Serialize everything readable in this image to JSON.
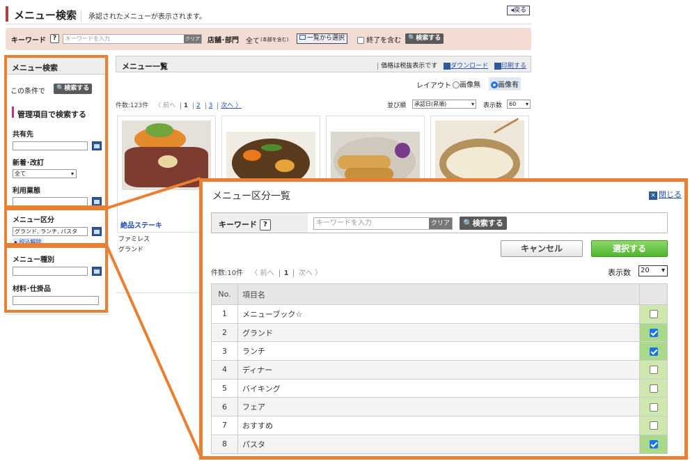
{
  "header": {
    "title": "メニュー検索",
    "description": "承認されたメニューが表示されます。",
    "back": "◂戻る"
  },
  "searchbar": {
    "keyword_label": "キーワード",
    "help": "?",
    "keyword_placeholder": "キーワードを入力",
    "clear": "クリア",
    "store_label": "店舗･部門",
    "store_value": "全て",
    "store_note": "(本部を含む)",
    "list_select": "一覧から選択",
    "include_ended": "終了を含む",
    "search": "検索する"
  },
  "sidebar": {
    "title": "メニュー検索",
    "this_condition": "この条件で",
    "search": "検索する",
    "section": "管理項目で検索する",
    "shared_label": "共有先",
    "new_label": "新着･改訂",
    "new_value": "全て",
    "usage_label": "利用業態",
    "category_label": "メニュー区分",
    "category_value": "グランド, ランチ, パスタ",
    "filter_clear": "絞込解除",
    "type_label": "メニュー種別",
    "material_label": "材料･仕掛品"
  },
  "main": {
    "title": "メニュー一覧",
    "tax_note": "価格は税抜表示です",
    "download": "ダウンロード",
    "print": "印刷する",
    "layout_label": "レイアウト",
    "no_image": "画像無",
    "with_image": "画像有",
    "count": "件数:123件",
    "prev": "〈 前へ",
    "pages": [
      "1",
      "2",
      "3"
    ],
    "next": "次へ 〉",
    "sort_label": "並び順",
    "sort_value": "承認日(昇順)",
    "display_label": "表示数",
    "display_value": "60",
    "item1_name": "絶品ステーキ",
    "item1_tag1": "ファミレス",
    "item1_tag2": "グランド"
  },
  "modal": {
    "title": "メニュー区分一覧",
    "close": "閉じる",
    "keyword_label": "キーワード",
    "help": "?",
    "placeholder": "キーワードを入力",
    "clear": "クリア",
    "search": "検索する",
    "cancel": "キャンセル",
    "select": "選択する",
    "count": "件数:10件",
    "prev": "〈 前へ",
    "page": "1",
    "next": "次へ 〉",
    "display_label": "表示数",
    "display_value": "20",
    "col_no": "No.",
    "col_name": "項目名",
    "rows": [
      {
        "no": "1",
        "name": "メニューブック☆",
        "checked": false
      },
      {
        "no": "2",
        "name": "グランド",
        "checked": true
      },
      {
        "no": "3",
        "name": "ランチ",
        "checked": true
      },
      {
        "no": "4",
        "name": "ディナー",
        "checked": false
      },
      {
        "no": "5",
        "name": "バイキング",
        "checked": false
      },
      {
        "no": "6",
        "name": "フェア",
        "checked": false
      },
      {
        "no": "7",
        "name": "おすすめ",
        "checked": false
      },
      {
        "no": "8",
        "name": "パスタ",
        "checked": true
      }
    ]
  },
  "colors": {
    "accent": "#e87f33",
    "check_bg": "#cfe8b0",
    "select_btn": "#4fb52e"
  }
}
